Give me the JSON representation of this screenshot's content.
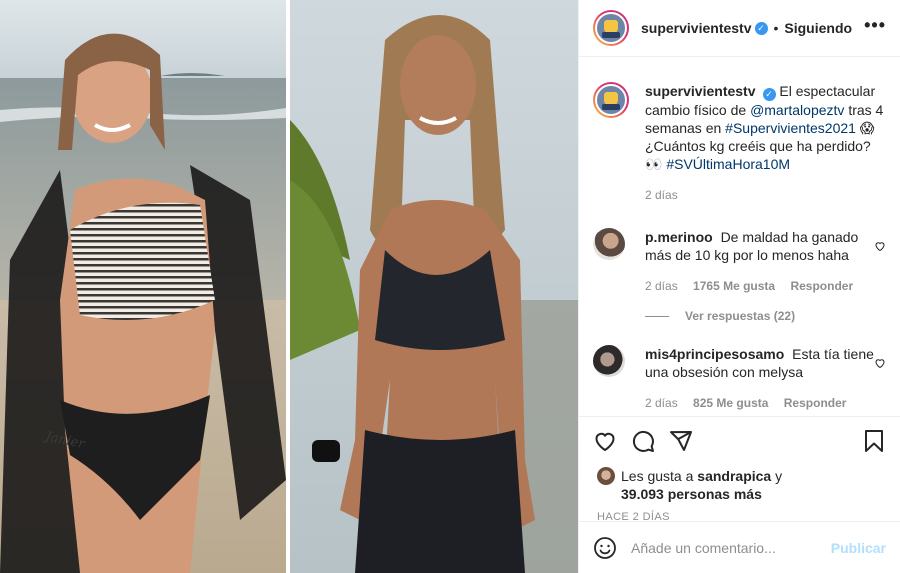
{
  "colors": {
    "link": "#00376b",
    "verified": "#3897f0",
    "muted": "#8e8e8e",
    "publish": "#b2dffc",
    "text": "#262626"
  },
  "media": {
    "left_tattoo_text": "Janier"
  },
  "header": {
    "username": "supervivientestv",
    "verified_icon": "verified-badge-icon",
    "separator": "•",
    "follow_label": "Siguiendo",
    "more_label": "•••"
  },
  "caption": {
    "username": "supervivientestv",
    "text_1": "El espectacular cambio físico de",
    "mention": "@martalopeztv",
    "text_2": "tras 4 semanas en",
    "hashtag_1": "#Supervivientes2021",
    "text_3": "😱 ¿Cuántos kg creéis que ha perdido? 👀",
    "hashtag_2": "#SVÚltimaHora10M",
    "time": "2 días"
  },
  "comments": [
    {
      "username": "p.merinoo",
      "text": "De maldad ha ganado más de 10 kg por lo menos haha",
      "time": "2 días",
      "likes": "1765 Me gusta",
      "reply": "Responder",
      "view_replies": "Ver respuestas (22)"
    },
    {
      "username": "mis4principesosamo",
      "text": "Esta tía tiene una obsesión con melysa",
      "time": "2 días",
      "likes": "825 Me gusta",
      "reply": "Responder"
    }
  ],
  "actions": {
    "icons": [
      "heart-icon",
      "comment-icon",
      "share-icon",
      "bookmark-icon"
    ],
    "likes_prefix": "Les gusta a",
    "likes_user": "sandrapica",
    "likes_suffix": "y",
    "likes_count": "39.093 personas más",
    "posted": "HACE 2 DÍAS"
  },
  "add_comment": {
    "placeholder": "Añade un comentario...",
    "publish_label": "Publicar",
    "emoji_icon": "emoji-icon"
  }
}
